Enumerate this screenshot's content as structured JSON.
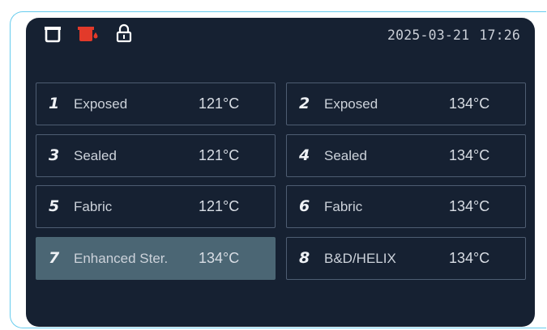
{
  "status_bar": {
    "date": "2025-03-21",
    "time": "17:26",
    "icons": [
      {
        "name": "chamber-icon",
        "color": "#ffffff"
      },
      {
        "name": "water-tank-icon",
        "color": "#e23a2a"
      },
      {
        "name": "door-lock-icon",
        "color": "#ffffff"
      }
    ]
  },
  "programs": [
    {
      "number": "1",
      "name": "Exposed",
      "temp": "121°C",
      "selected": false
    },
    {
      "number": "2",
      "name": "Exposed",
      "temp": "134°C",
      "selected": false
    },
    {
      "number": "3",
      "name": "Sealed",
      "temp": "121°C",
      "selected": false
    },
    {
      "number": "4",
      "name": "Sealed",
      "temp": "134°C",
      "selected": false
    },
    {
      "number": "5",
      "name": "Fabric",
      "temp": "121°C",
      "selected": false
    },
    {
      "number": "6",
      "name": "Fabric",
      "temp": "134°C",
      "selected": false
    },
    {
      "number": "7",
      "name": "Enhanced Ster.",
      "temp": "134°C",
      "selected": true
    },
    {
      "number": "8",
      "name": "B&D/HELIX",
      "temp": "134°C",
      "selected": false
    }
  ],
  "colors": {
    "screen_bg": "#162132",
    "selected_bg": "#4b6674",
    "border": "#4e5d72",
    "alert": "#e23a2a",
    "frame_accent": "#66ccee"
  }
}
